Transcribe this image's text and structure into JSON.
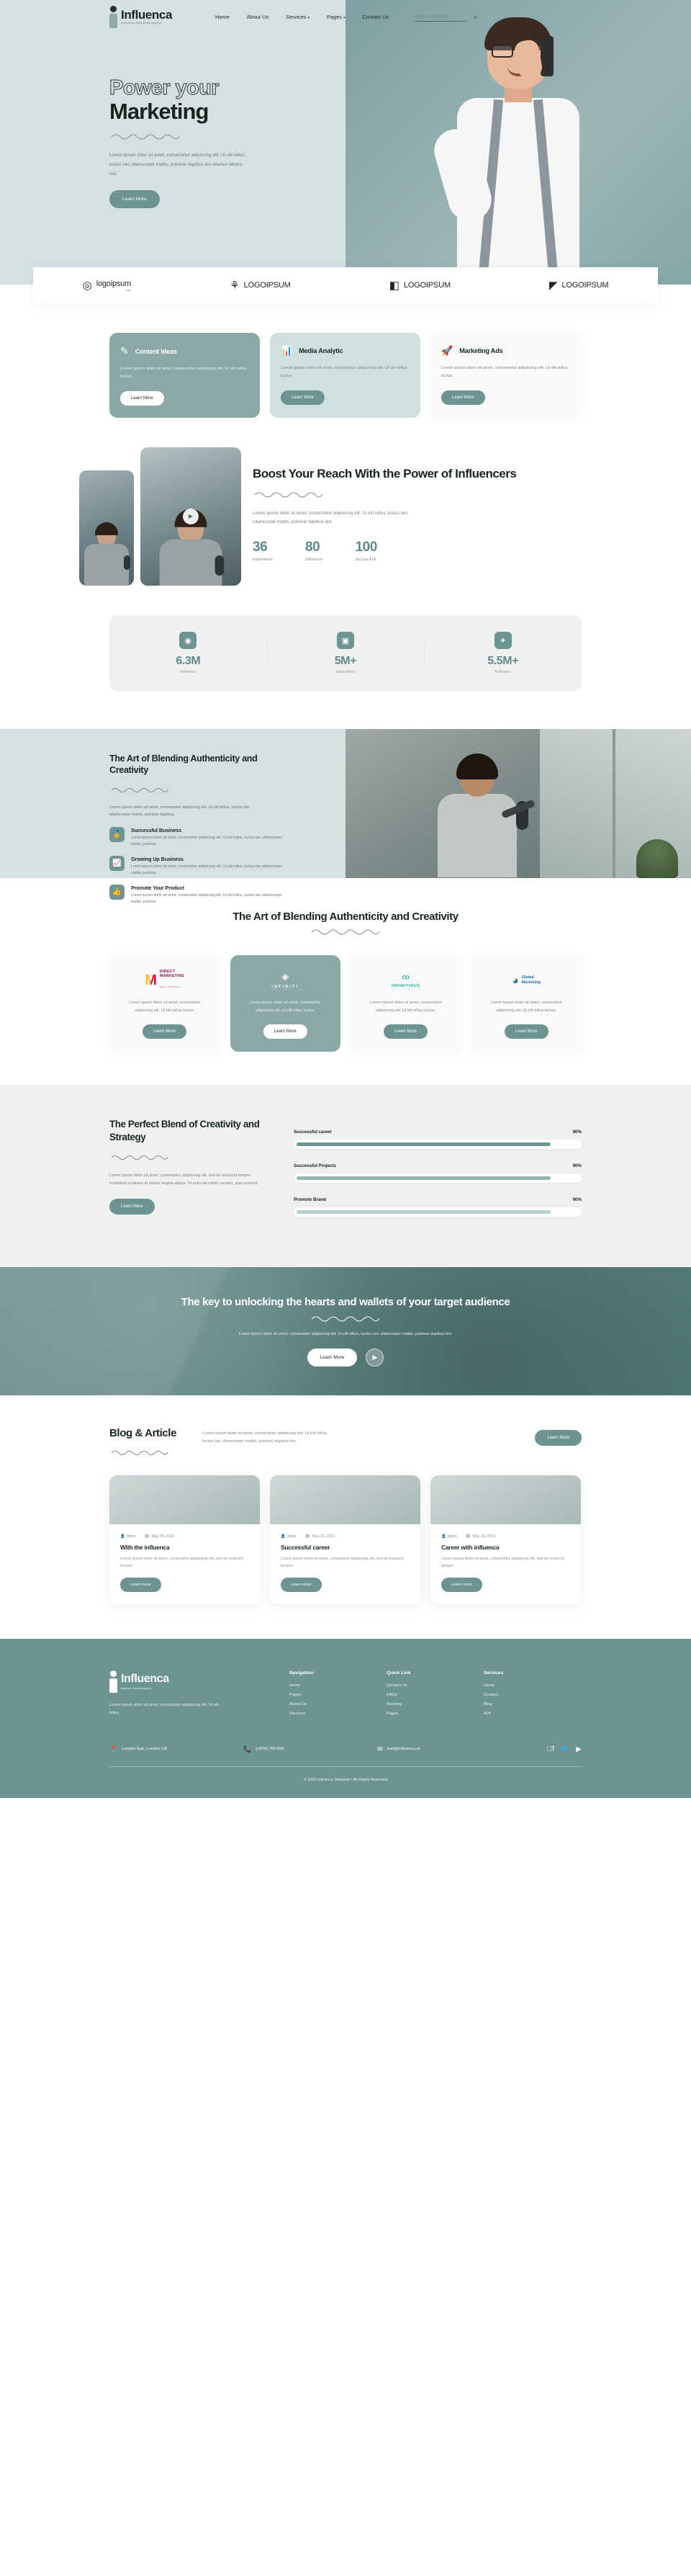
{
  "header": {
    "logo_word": "Influenca",
    "logo_sub": "Influencer Marketing Agency",
    "nav": [
      {
        "label": "Home",
        "caret": false
      },
      {
        "label": "About Us",
        "caret": false
      },
      {
        "label": "Services",
        "caret": true
      },
      {
        "label": "Pages",
        "caret": true
      },
      {
        "label": "Contact Us",
        "caret": false
      }
    ],
    "search_placeholder": "Type & Hit Enter..",
    "search_value": ""
  },
  "hero": {
    "line1": "Power your",
    "line2": "Marketing",
    "paragraph": "Lorem ipsum dolor sit amet, consectetur adipiscing elit. Ut elit tellus, luctus nec ullamcorper mattis, pulvinar dapibus leo ullamco laboris nisi.",
    "button": "Learn More"
  },
  "brands": [
    {
      "glyph": "◎",
      "name": "logoipsum",
      "sub": ".com"
    },
    {
      "glyph": "⚘",
      "name": "LOGOIPSUM",
      "sub": ""
    },
    {
      "glyph": "◧",
      "name": "LOGOIPSUM",
      "sub": ""
    },
    {
      "glyph": "◤",
      "name": "LOGOIPSUM",
      "sub": ""
    }
  ],
  "services": [
    {
      "icon": "✎",
      "title": "Content Ideas",
      "desc": "Lorem ipsum dolor sit amet, consectetur adipiscing elit. Ut elit tellus luctus.",
      "button": "Learn More",
      "style": "teal"
    },
    {
      "icon": "📊",
      "title": "Media Analytic",
      "desc": "Lorem ipsum dolor sit amet, consectetur adipiscing elit. Ut elit tellus luctus",
      "button": "Learn More",
      "style": "soft"
    },
    {
      "icon": "🚀",
      "title": "Marketing Ads",
      "desc": "Lorem ipsum dolor sit amet, consectetur adipiscing elit. Ut elit tellus luctus.",
      "button": "Learn More",
      "style": "white"
    }
  ],
  "boost": {
    "heading": "Boost Your Reach With the Power of Influencers",
    "paragraph": "Lorem ipsum dolor sit amet, consectetur adipiscing elit. Ut elit tellus, luctus nec ullamcorper mattis, pulvinar dapibus leo.",
    "stats": [
      {
        "number": "36",
        "label": "Experience"
      },
      {
        "number": "80",
        "label": "Influencer"
      },
      {
        "number": "100",
        "label": "Succes Full"
      }
    ]
  },
  "social_stats": [
    {
      "icon": "instagram-icon",
      "glyph": "◉",
      "number": "6.3M",
      "label": "Followers"
    },
    {
      "icon": "youtube-icon",
      "glyph": "▣",
      "number": "5M+",
      "label": "Subscribers"
    },
    {
      "icon": "twitter-icon",
      "glyph": "✦",
      "number": "5.5M+",
      "label": "Followers"
    }
  ],
  "art_split": {
    "heading": "The Art of Blending Authenticity and Creativity",
    "paragraph": "Lorem ipsum dolor sit amet, consectetur adipiscing elit. Ut elit tellus, luctus nec ullamcorper mattis, pulvinar dapibus.",
    "features": [
      {
        "icon": "badge-icon",
        "glyph": "🏅",
        "title": "Successful Business",
        "desc": "Lorem ipsum dolor sit amet, consectetur adipiscing elit. Ut elit tellus, luctus nec ullamcorper mattis, pulvinar."
      },
      {
        "icon": "growth-chart-icon",
        "glyph": "📈",
        "title": "Growing Up Business",
        "desc": "Lorem ipsum dolor sit amet, consectetur adipiscing elit. Ut elit tellus, luctus nec ullamcorper mattis, pulvinar."
      },
      {
        "icon": "thumbs-up-icon",
        "glyph": "👍",
        "title": "Promote Your Product",
        "desc": "Lorem ipsum dolor sit amet, consectetur adipiscing elit. Ut elit tellus, luctus nec ullamcorper mattis, pulvinar."
      }
    ]
  },
  "art_section": {
    "heading": "The Art of Blending Authenticity and Creativity",
    "cards": [
      {
        "logo_name": "direct-marketing-logo",
        "logo_mark": "M",
        "logo_line1": "DIRECT",
        "logo_line2": "MARKETING",
        "logo_sub": "SMALL MARKETING",
        "desc": "Lorem ipsum dolor sit amet, consectetur adipiscing elit. Ut elit tellus luctus.",
        "button": "Learn More",
        "style": "white"
      },
      {
        "logo_name": "infiniti-logo",
        "logo_mark": "◈",
        "logo_line1": "INFINITI",
        "logo_line2": "",
        "logo_sub": "LOREM IPSUM DOLOR",
        "desc": "Lorem ipsum dolor sit amet, consectetur adipiscing elit. Ut elit tellus luctus.",
        "button": "Learn More",
        "style": "teal"
      },
      {
        "logo_name": "infinitious-logo",
        "logo_mark": "∞",
        "logo_line1": "INFINITIOUS",
        "logo_line2": "",
        "logo_sub": "LOREM IPSUM DOLOR",
        "desc": "Lorem ipsum dolor sit amet, consectetur adipiscing elit. Ut elit tellus luctus.",
        "button": "Learn More",
        "style": "white"
      },
      {
        "logo_name": "global-marketing-logo",
        "logo_mark": "◕",
        "logo_line1": "Global",
        "logo_line2": "Marketing",
        "logo_sub": "",
        "desc": "Lorem ipsum dolor sit amet, consectetur adipiscing elit. Ut elit tellus luctus.",
        "button": "Learn More",
        "style": "white"
      }
    ]
  },
  "blend": {
    "heading": "The Perfect Blend of Creativity and Strategy",
    "paragraph": "Lorem ipsum dolor sit amet, consectetur adipiscing elit, sed do eiusmod tempor incididunt ut labore et dolore magna aliqua. Ut enim ad minim veniam, quis nostrud.",
    "button": "Learn More",
    "bars": [
      {
        "label": "Successful career",
        "percent": "90%",
        "value": 90
      },
      {
        "label": "Successful Projects",
        "percent": "90%",
        "value": 90
      },
      {
        "label": "Promote Brand",
        "percent": "90%",
        "value": 90
      }
    ]
  },
  "cta": {
    "heading": "The key to unlocking the hearts and wallets of your target audience",
    "paragraph": "Lorem ipsum dolor sit amet, consectetur adipiscing elit. Ut elit tellus, luctus nec ullamcorper mattis, pulvinar dapibus leo.",
    "button": "Learn More",
    "play": "▶"
  },
  "blog": {
    "heading": "Blog & Article",
    "intro": "Lorem ipsum dolor sit amet, consectetur adipiscing elit. Ut elit tellus, luctus nec ullamcorper mattis, pulvinar dapibus leo.",
    "button": "Learn More",
    "posts": [
      {
        "author": "kitpro",
        "date": "May 29, 2023",
        "title": "With the influenca",
        "desc": "Lorem ipsum dolor sit amet, consectetur adipiscing elit, sed do eiusmod tempor.",
        "button": "Learn more"
      },
      {
        "author": "kitpro",
        "date": "May 29, 2023",
        "title": "Successful career",
        "desc": "Lorem ipsum dolor sit amet, consectetur adipiscing elit, sed do eiusmod tempor.",
        "button": "Learn more"
      },
      {
        "author": "kitpro",
        "date": "May 29, 2023",
        "title": "Career with influenca",
        "desc": "Lorem ipsum dolor sit amet, consectetur adipiscing elit, sed do eiusmod tempor.",
        "button": "Learn more"
      }
    ]
  },
  "footer": {
    "logo_word": "Influenca",
    "logo_sub": "Influencer Marketing Agency",
    "desc": "Lorem ipsum dolor sit amet, consectetur adipiscing elit. Ut elit tellus.",
    "columns": [
      {
        "title": "Navigation",
        "links": [
          "Home",
          "Pages",
          "About Us",
          "Services"
        ]
      },
      {
        "title": "Quick Link",
        "links": [
          "Contact Us",
          "FAQs",
          "Booking",
          "Pages"
        ]
      },
      {
        "title": "Services",
        "links": [
          "Home",
          "Contact",
          "Blog",
          "404"
        ]
      }
    ],
    "contact": [
      {
        "icon": "location-pin-icon",
        "glyph": "📍",
        "text": "London Eye, London UK"
      },
      {
        "icon": "phone-icon",
        "glyph": "📞",
        "text": "(+876) 765 665"
      },
      {
        "icon": "mail-icon",
        "glyph": "✉",
        "text": "mail@influenca.id"
      }
    ],
    "socials": [
      {
        "icon": "facebook-icon",
        "glyph": "f"
      },
      {
        "icon": "twitter-icon",
        "glyph": "🐦"
      },
      {
        "icon": "youtube-icon",
        "glyph": "▶"
      }
    ],
    "copyright": "© 2023 Influenca Template • All Rights Reserved"
  },
  "colors": {
    "brand_teal": "#6c9492",
    "hero_bg": "#d3e1e3",
    "card_teal": "#8aa9a6",
    "dark_text": "#17251f"
  }
}
